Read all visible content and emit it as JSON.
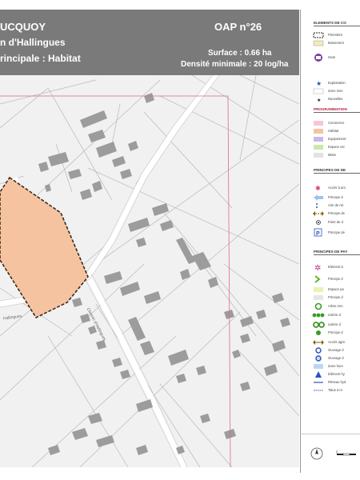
{
  "header": {
    "commune": "UCQUOY",
    "site": "n d'Hallingues",
    "vocation": "rincipale : Habitat",
    "oap": "OAP n°26",
    "surface": "Surface : 0.66 ha",
    "densite": "Densité minimale : 20 log/ha"
  },
  "map": {
    "street_label_1": "Chemin d'Hallingues",
    "street_label_2": "Hallingues"
  },
  "legend": {
    "sections": [
      {
        "title": "ELEMENTS DE CO",
        "red": false,
        "items": [
          {
            "symbol": "perimeter",
            "label": "Périmètre"
          },
          {
            "symbol": "boisement",
            "label": "Boisement"
          },
          {
            "symbol": "gare",
            "label": "Gare"
          },
          {
            "symbol": "star-blue",
            "label": "Exploitation"
          },
          {
            "symbol": "zone",
            "label": "Zone inon"
          },
          {
            "symbol": "star-black",
            "label": "Nouvelles"
          }
        ]
      },
      {
        "title": "PROGRAMMATION",
        "red": true,
        "items": [
          {
            "symbol": "fill-pink",
            "label": "Commerce"
          },
          {
            "symbol": "fill-orange",
            "label": "Habitat"
          },
          {
            "symbol": "fill-purple",
            "label": "Equipement"
          },
          {
            "symbol": "fill-green",
            "label": "Espace ver"
          },
          {
            "symbol": "fill-grey",
            "label": "Mixte"
          }
        ]
      },
      {
        "title": "PRINCIPES DE DE",
        "red": false,
        "items": [
          {
            "symbol": "star-pink",
            "label": "Accès à am"
          },
          {
            "symbol": "arrow-blue",
            "label": "Principe d"
          },
          {
            "symbol": "dots-blue",
            "label": "Aire de ret"
          },
          {
            "symbol": "arrow-brown",
            "label": "Principe de"
          },
          {
            "symbol": "dot-target",
            "label": "Point de d"
          },
          {
            "symbol": "parking",
            "label": "Principe de"
          }
        ]
      },
      {
        "title": "PRINCIPES DE PAY",
        "red": false,
        "items": [
          {
            "symbol": "flower",
            "label": "Elément à"
          },
          {
            "symbol": "chevron-green",
            "label": "Principe d"
          },
          {
            "symbol": "fill-lightgreen",
            "label": "Espace pa"
          },
          {
            "symbol": "fill-lightgrey",
            "label": "Principe d"
          },
          {
            "symbol": "tree-circle",
            "label": "Arbre rem"
          },
          {
            "symbol": "tree-row",
            "label": "Lisière d"
          },
          {
            "symbol": "tree-row2",
            "label": "Lisière d"
          },
          {
            "symbol": "tree-single",
            "label": "Principe d"
          },
          {
            "symbol": "arrow-double",
            "label": "Accès agric"
          },
          {
            "symbol": "ring-blue",
            "label": "Ouvrage d"
          },
          {
            "symbol": "ring-blue2",
            "label": "Ouvrage d"
          },
          {
            "symbol": "fill-blue",
            "label": "Zone hum"
          },
          {
            "symbol": "tri-blue",
            "label": "Elément hy"
          },
          {
            "symbol": "line-blue",
            "label": "Réseau hyd"
          },
          {
            "symbol": "dash-blue",
            "label": "Talus à m"
          }
        ]
      }
    ]
  },
  "colors": {
    "header_bg": "#7a7a7a",
    "habitat_fill": "#f6c3a0",
    "perimeter_stroke": "#3a2a1a",
    "frame_stroke": "#e06a8a",
    "building": "#9c9c9c"
  },
  "icons": [
    "north-arrow-icon",
    "scale-bar-icon"
  ]
}
